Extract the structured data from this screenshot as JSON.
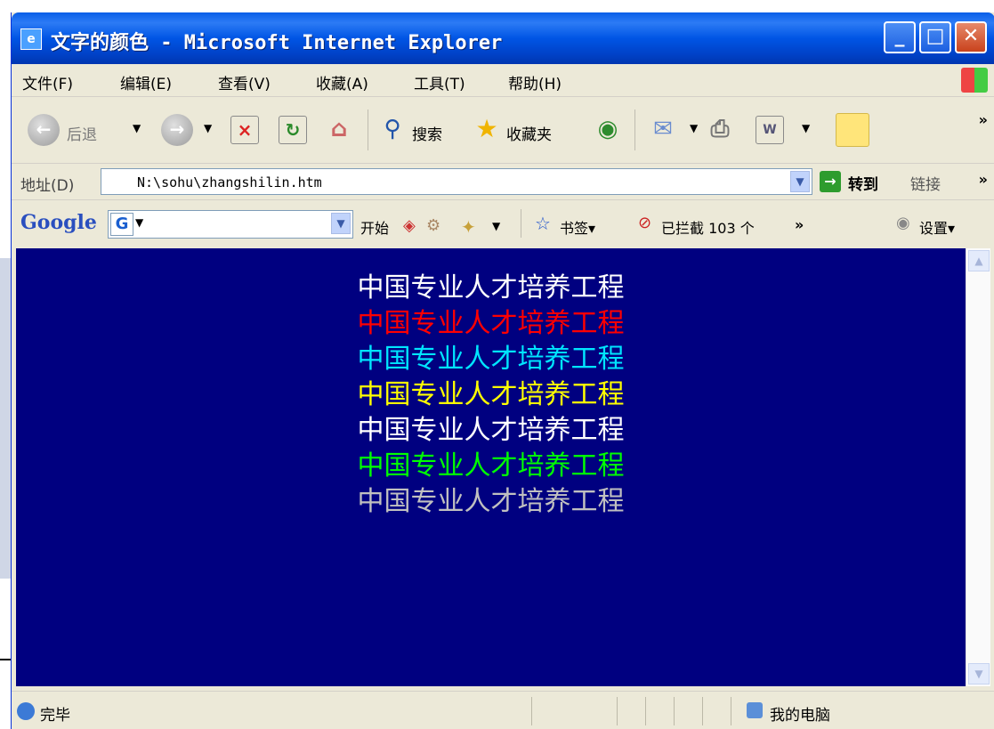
{
  "window": {
    "title": "文字的颜色 - Microsoft Internet Explorer"
  },
  "menu": [
    "文件(F)",
    "编辑(E)",
    "查看(V)",
    "收藏(A)",
    "工具(T)",
    "帮助(H)"
  ],
  "toolbar": {
    "back": "后退",
    "search": "搜索",
    "favorites": "收藏夹",
    "more": "»"
  },
  "address": {
    "label": "地址(D)",
    "value": "N:\\sohu\\zhangshilin.htm",
    "go": "转到",
    "links": "链接",
    "more": "»"
  },
  "google_bar": {
    "logo": "Google",
    "start": "开始",
    "bookmarks": "书签▾",
    "blocked": "已拦截 103 个",
    "more": "»",
    "settings": "设置▾"
  },
  "content": {
    "lines": [
      {
        "text": "中国专业人才培养工程",
        "color": "#ffffff"
      },
      {
        "text": "中国专业人才培养工程",
        "color": "#ff0000"
      },
      {
        "text": "中国专业人才培养工程",
        "color": "#00e5ff"
      },
      {
        "text": "中国专业人才培养工程",
        "color": "#ffff00"
      },
      {
        "text": "中国专业人才培养工程",
        "color": "#ffffff"
      },
      {
        "text": "中国专业人才培养工程",
        "color": "#00ff00"
      },
      {
        "text": "中国专业人才培养工程",
        "color": "#c0c0c0"
      }
    ]
  },
  "status": {
    "text": "完毕",
    "zone": "我的电脑"
  }
}
